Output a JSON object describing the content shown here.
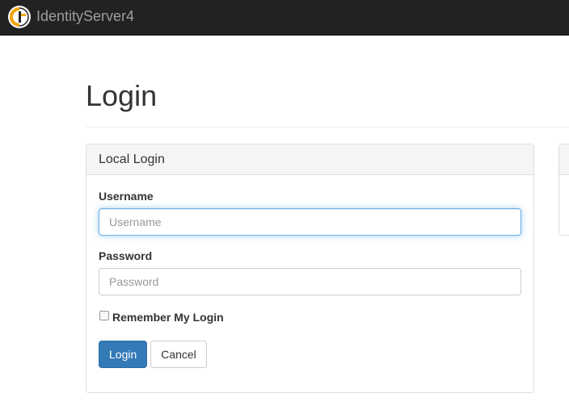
{
  "navbar": {
    "brand_name": "IdentityServer4",
    "logo_icon": "identityserver-logo-icon",
    "background": "#222222"
  },
  "page": {
    "title": "Login"
  },
  "local_login": {
    "panel_title": "Local Login",
    "username": {
      "label": "Username",
      "placeholder": "Username",
      "value": ""
    },
    "password": {
      "label": "Password",
      "placeholder": "Password",
      "value": ""
    },
    "remember": {
      "label": "Remember My Login",
      "checked": false
    },
    "login_button": "Login",
    "cancel_button": "Cancel"
  },
  "colors": {
    "primary": "#337ab7",
    "focus": "#66afe9",
    "logo_accent": "#f0a30a"
  }
}
